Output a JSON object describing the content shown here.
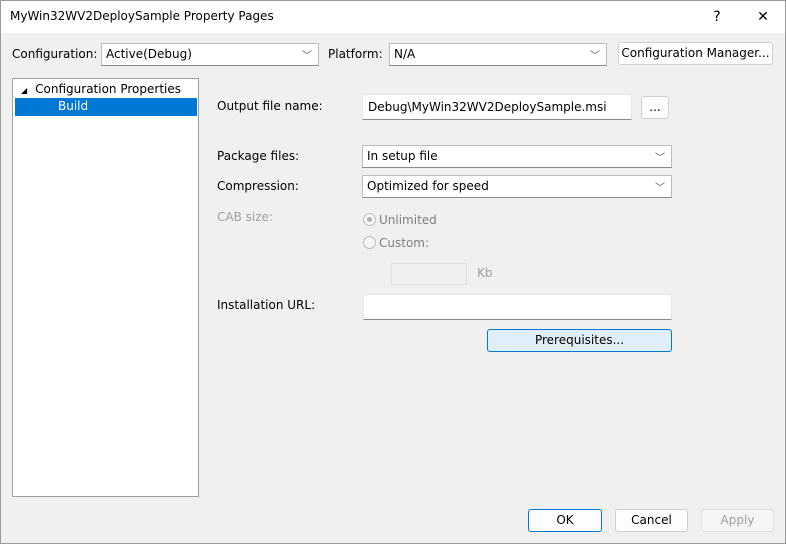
{
  "window": {
    "title": "MyWin32WV2DeploySample Property Pages",
    "help": "?",
    "close": "✕"
  },
  "toolbar": {
    "configuration_label": "Configuration:",
    "configuration_value": "Active(Debug)",
    "platform_label": "Platform:",
    "platform_value": "N/A",
    "config_manager": "Configuration Manager..."
  },
  "tree": {
    "root": "Configuration Properties",
    "items": [
      {
        "label": "Build",
        "selected": true
      }
    ]
  },
  "form": {
    "output_label": "Output file name:",
    "output_value": "Debug\\MyWin32WV2DeploySample.msi",
    "browse": "...",
    "package_label": "Package files:",
    "package_value": "In setup file",
    "compression_label": "Compression:",
    "compression_value": "Optimized for speed",
    "cab_label": "CAB size:",
    "unlimited": "Unlimited",
    "custom": "Custom:",
    "kb": "Kb",
    "cab_selected": "Unlimited",
    "url_label": "Installation URL:",
    "url_value": "",
    "prerequisites": "Prerequisites..."
  },
  "footer": {
    "ok": "OK",
    "cancel": "Cancel",
    "apply": "Apply"
  },
  "colors": {
    "accent": "#0078d4",
    "selection": "#0078d4",
    "focus_button_bg": "#e0eef9"
  }
}
